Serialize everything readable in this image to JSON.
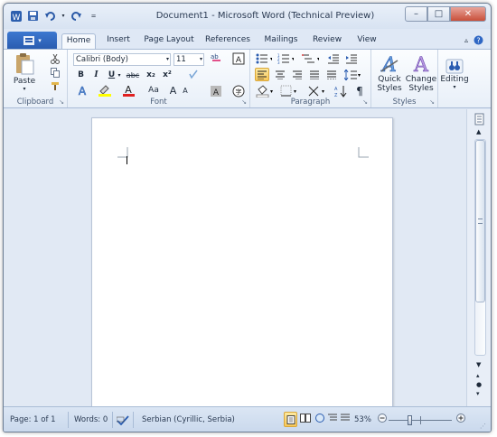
{
  "window": {
    "title": "Document1  -  Microsoft Word (Technical Preview)",
    "controls": {
      "minimize": "–",
      "maximize": "□",
      "close": "✕"
    }
  },
  "qat": {
    "word_icon": "word-logo-icon",
    "save": "save-icon",
    "undo": "undo-icon",
    "redo": "redo-icon",
    "customize": "customize-arrow-icon"
  },
  "tabs": [
    "Home",
    "Insert",
    "Page Layout",
    "References",
    "Mailings",
    "Review",
    "View"
  ],
  "active_tab": "Home",
  "ribbon": {
    "clipboard": {
      "label": "Clipboard",
      "paste": "Paste"
    },
    "font": {
      "label": "Font",
      "font_name": "Calibri (Body)",
      "font_size": "11",
      "bold": "B",
      "italic": "I",
      "underline": "U",
      "strike": "abc",
      "subscript": "x₂",
      "superscript": "x²",
      "change_case": "Aa",
      "grow": "A",
      "shrink": "A",
      "text_effect": "A",
      "font_color": "A",
      "highlight": "ab"
    },
    "paragraph": {
      "label": "Paragraph"
    },
    "styles": {
      "label": "Styles",
      "quick_styles": "Quick\nStyles",
      "change_styles": "Change\nStyles"
    },
    "editing": {
      "label": "Editing"
    }
  },
  "status": {
    "page": "Page: 1 of 1",
    "words": "Words: 0",
    "language": "Serbian (Cyrillic, Serbia)",
    "zoom": "53%",
    "zoom_level": 0.34
  },
  "colors": {
    "accent": "#2a5cb0",
    "highlight": "#ffff00",
    "font_red": "#e02020"
  }
}
